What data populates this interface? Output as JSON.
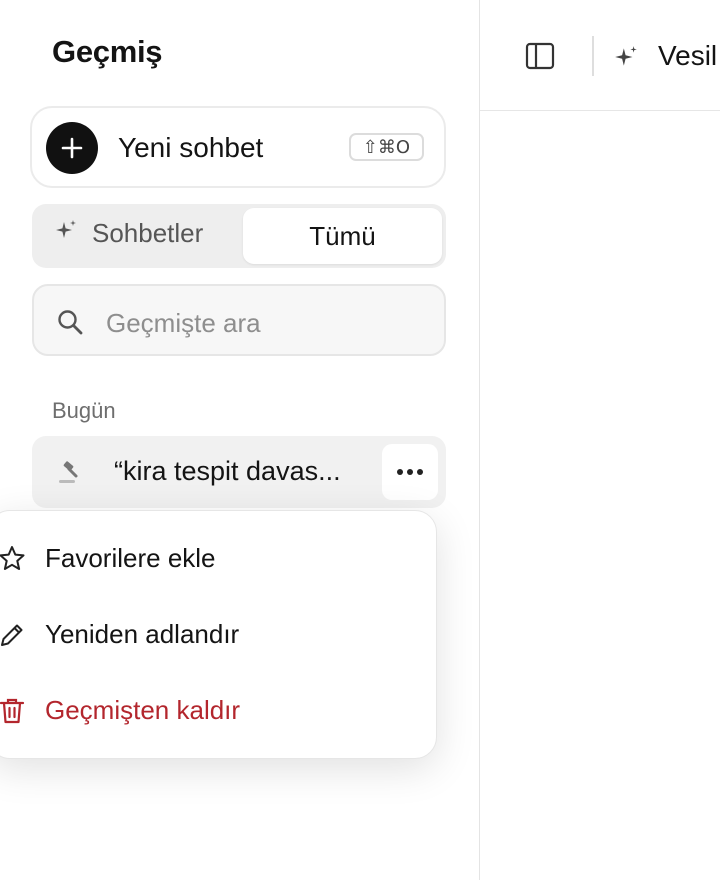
{
  "sidebar": {
    "title": "Geçmiş",
    "new_chat": {
      "label": "Yeni sohbet",
      "shortcut": "⇧⌘O"
    },
    "tabs": [
      {
        "label": "Sohbetler",
        "icon": "sparkle-icon",
        "active": false
      },
      {
        "label": "Tümü",
        "active": true
      }
    ],
    "search": {
      "placeholder": "Geçmişte ara",
      "value": ""
    },
    "section_label": "Bugün",
    "items": [
      {
        "title": "“kira tespit davas...",
        "icon": "gavel-icon"
      }
    ]
  },
  "context_menu": {
    "items": [
      {
        "label": "Favorilere ekle",
        "icon": "star-icon"
      },
      {
        "label": "Yeniden adlandır",
        "icon": "pencil-icon"
      },
      {
        "label": "Geçmişten kaldır",
        "icon": "trash-icon",
        "color": "#b3262d"
      }
    ]
  },
  "header": {
    "model_label": "Vesil"
  },
  "colors": {
    "accent": "#111111",
    "danger": "#b3262d",
    "border": "#e4e4e4"
  }
}
